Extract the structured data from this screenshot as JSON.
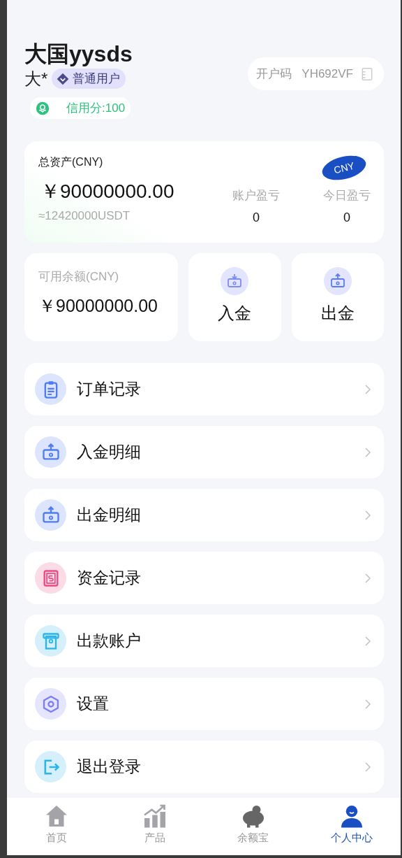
{
  "profile": {
    "name": "大国yysds",
    "short_name": "大*",
    "level_badge": "普通用户",
    "account_code_label": "开户码",
    "account_code": "YH692VF",
    "credit": "信用分:100"
  },
  "assets": {
    "title": "总资产(CNY)",
    "currency_badge": "CNY",
    "amount": "￥90000000.00",
    "usdt": "≈12420000USDT",
    "stats": [
      {
        "label": "账户盈亏",
        "value": "0"
      },
      {
        "label": "今日盈亏",
        "value": "0"
      }
    ]
  },
  "balance": {
    "label": "可用余额(CNY)",
    "amount": "￥90000000.00"
  },
  "actions": [
    {
      "label": "入金"
    },
    {
      "label": "出金"
    }
  ],
  "menu": [
    {
      "label": "订单记录",
      "color": "#4f7cf3"
    },
    {
      "label": "入金明细",
      "color": "#4f7cf3"
    },
    {
      "label": "出金明细",
      "color": "#4f7cf3"
    },
    {
      "label": "资金记录",
      "color": "#ec4a82"
    },
    {
      "label": "出款账户",
      "color": "#2bb5e8"
    },
    {
      "label": "设置",
      "color": "#7b7ef5"
    },
    {
      "label": "退出登录",
      "color": "#2bb5e8"
    }
  ],
  "tab_bar": [
    {
      "label": "首页",
      "selected": false
    },
    {
      "label": "产品",
      "selected": false
    },
    {
      "label": "余额宝",
      "selected": false
    },
    {
      "label": "个人中心",
      "selected": true
    }
  ]
}
